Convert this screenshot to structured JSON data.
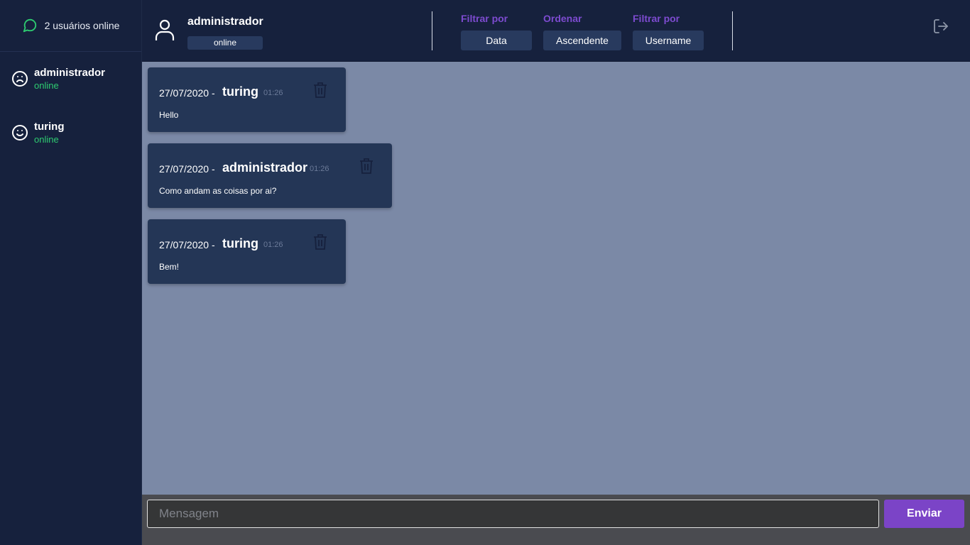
{
  "sidebar": {
    "online_count_label": "2 usuários online",
    "users": [
      {
        "name": "administrador",
        "status": "online",
        "face_icon": "sad-face-icon"
      },
      {
        "name": "turing",
        "status": "online",
        "face_icon": "smile-face-icon"
      }
    ]
  },
  "header": {
    "current_user": "administrador",
    "current_status": "online",
    "filters": [
      {
        "label": "Filtrar por",
        "value": "Data"
      },
      {
        "label": "Ordenar",
        "value": "Ascendente"
      },
      {
        "label": "Filtrar por",
        "value": "Username"
      }
    ]
  },
  "messages": [
    {
      "date": "27/07/2020 -",
      "user": "turing",
      "time": "01:26",
      "text": "Hello"
    },
    {
      "date": "27/07/2020 -",
      "user": "administrador",
      "time": "01:26",
      "text": "Como andam as coisas por ai?"
    },
    {
      "date": "27/07/2020 -",
      "user": "turing",
      "time": "01:26",
      "text": "Bem!"
    }
  ],
  "composer": {
    "placeholder": "Mensagem",
    "send_label": "Enviar"
  },
  "colors": {
    "accent": "#7b44c7",
    "online": "#2ecc71",
    "panel": "#16213d",
    "card": "#243656",
    "chat_bg": "#7b89a6"
  }
}
